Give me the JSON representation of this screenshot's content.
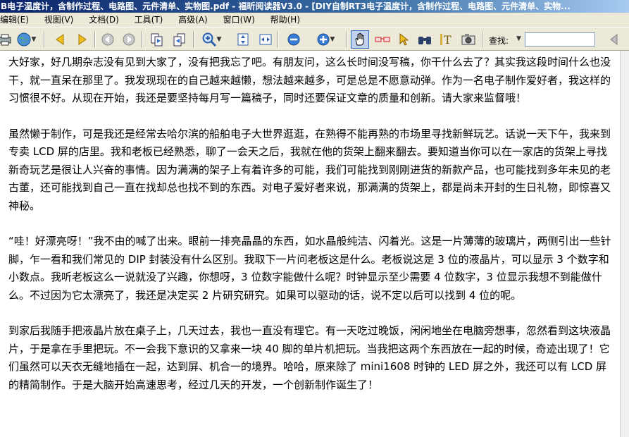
{
  "window": {
    "title": "B电子温度计，含制作过程、电路图、元件清单、实物图.pdf - 福昕阅读器V3.0 - [DIY自制RT3电子温度计，含制作过程、电路图、元件清单、实物..."
  },
  "menu": {
    "items": [
      "编辑(E)",
      "视图(V)",
      "文档(D)",
      "工具(T)",
      "高级(A)",
      "窗口(W)",
      "帮助(H)"
    ]
  },
  "toolbar": {
    "search_label": "查找:",
    "search_value": "",
    "icons": [
      "print-icon",
      "globe-icon",
      "prev-arrow-icon",
      "next-arrow-icon",
      "back-icon",
      "forward-icon",
      "copy-page-icon",
      "paste-page-icon",
      "zoom-in-icon",
      "fit-page-icon",
      "fit-width-icon",
      "zoom-out-minus-icon",
      "zoom-in-plus-icon",
      "hand-tool-icon",
      "glasses-icon",
      "select-arrow-icon",
      "binoculars-icon",
      "text-tool-icon",
      "snapshot-icon"
    ]
  },
  "document": {
    "paragraphs": [
      "大好家，好几期杂志没有见到大家了，没有把我忘了吧。有朋友问，这么长时间没写稿，你干什么去了？其实我这段时间什么也没干，就一直呆在那里了。我发现现在的自己越来越懒，想法越来越多，可是总是不愿意动弹。作为一名电子制作爱好者，我这样的习惯很不好。从现在开始，我还是要坚持每月写一篇稿子，同时还要保证文章的质量和创新。请大家来监督哦！",
      "虽然懒于制作，可是我还是经常去哈尔滨的船舶电子大世界逛逛，在熟得不能再熟的市场里寻找新鲜玩艺。话说一天下午，我来到专卖 LCD 屏的店里。我和老板已经熟悉，聊了一会天之后，我就在他的货架上翻来翻去。要知道当你可以在一家店的货架上寻找新奇玩艺是很让人兴奋的事情。因为满满的架子上有着许多的可能，我们可能找到刚刚进货的新款产品，也可能找到多年未见的老古董，还可能找到自己一直在找却总也找不到的东西。对电子爱好者来说，那满满的货架上，都是尚未开封的生日礼物，即惊喜又神秘。",
      "“哇！好漂亮呀！”我不由的喊了出来。眼前一排亮晶晶的东西，如水晶般纯洁、闪着光。这是一片薄薄的玻璃片，两侧引出一些针脚，乍一看和我们常见的 DIP 封装没有什么区别。我取下一片问老板这是什么。老板说这是 3 位的液晶片，可以显示 3 个数字和小数点。我听老板这么一说就没了兴趣，你想呀，3 位数字能做什么呢？时钟显示至少需要 4 位数字，3 位显示我想不到能做什么。不过因为它太漂亮了，我还是决定买 2 片研究研究。如果可以驱动的话，说不定以后可以找到 4 位的呢。",
      "到家后我随手把液晶片放在桌子上，几天过去，我也一直没有理它。有一天吃过晚饭，闲闲地坐在电脑旁想事，忽然看到这块液晶片，于是拿在手里把玩。不一会我下意识的又拿来一块 40 脚的单片机把玩。当我把这两个东西放在一起的时候，奇迹出现了！它们虽然可以天衣无缝地插在一起，达到屏、机合一的境界。哈哈，原来除了 mini1608 时钟的 LED 屏之外，我还可以有 LCD 屏的精简制作。于是大脑开始高速思考，经过几天的开发，一个创新制作诞生了！"
    ]
  }
}
